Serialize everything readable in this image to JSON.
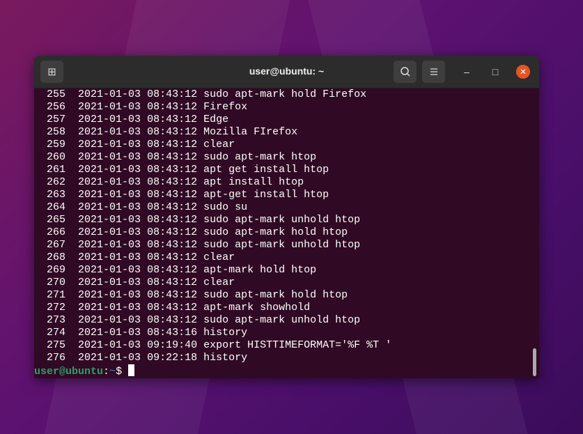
{
  "window": {
    "title": "user@ubuntu: ~"
  },
  "header": {
    "new_tab_icon": "new-tab-icon",
    "search_icon": "search-icon",
    "menu_icon": "hamburger-menu-icon",
    "minimize": "–",
    "maximize": "□",
    "close": "✕"
  },
  "history": [
    {
      "num": "255",
      "date": "2021-01-03",
      "time": "08:43:12",
      "cmd": "sudo apt-mark hold Firefox"
    },
    {
      "num": "256",
      "date": "2021-01-03",
      "time": "08:43:12",
      "cmd": "Firefox"
    },
    {
      "num": "257",
      "date": "2021-01-03",
      "time": "08:43:12",
      "cmd": "Edge"
    },
    {
      "num": "258",
      "date": "2021-01-03",
      "time": "08:43:12",
      "cmd": "Mozilla FIrefox"
    },
    {
      "num": "259",
      "date": "2021-01-03",
      "time": "08:43:12",
      "cmd": "clear"
    },
    {
      "num": "260",
      "date": "2021-01-03",
      "time": "08:43:12",
      "cmd": "sudo apt-mark htop"
    },
    {
      "num": "261",
      "date": "2021-01-03",
      "time": "08:43:12",
      "cmd": "apt get install htop"
    },
    {
      "num": "262",
      "date": "2021-01-03",
      "time": "08:43:12",
      "cmd": "apt install htop"
    },
    {
      "num": "263",
      "date": "2021-01-03",
      "time": "08:43:12",
      "cmd": "apt-get install htop"
    },
    {
      "num": "264",
      "date": "2021-01-03",
      "time": "08:43:12",
      "cmd": "sudo su"
    },
    {
      "num": "265",
      "date": "2021-01-03",
      "time": "08:43:12",
      "cmd": "sudo apt-mark unhold htop"
    },
    {
      "num": "266",
      "date": "2021-01-03",
      "time": "08:43:12",
      "cmd": "sudo apt-mark hold htop"
    },
    {
      "num": "267",
      "date": "2021-01-03",
      "time": "08:43:12",
      "cmd": "sudo apt-mark unhold htop"
    },
    {
      "num": "268",
      "date": "2021-01-03",
      "time": "08:43:12",
      "cmd": "clear"
    },
    {
      "num": "269",
      "date": "2021-01-03",
      "time": "08:43:12",
      "cmd": "apt-mark hold htop"
    },
    {
      "num": "270",
      "date": "2021-01-03",
      "time": "08:43:12",
      "cmd": "clear"
    },
    {
      "num": "271",
      "date": "2021-01-03",
      "time": "08:43:12",
      "cmd": "sudo apt-mark hold htop"
    },
    {
      "num": "272",
      "date": "2021-01-03",
      "time": "08:43:12",
      "cmd": "apt-mark showhold"
    },
    {
      "num": "273",
      "date": "2021-01-03",
      "time": "08:43:12",
      "cmd": "sudo apt-mark unhold htop"
    },
    {
      "num": "274",
      "date": "2021-01-03",
      "time": "08:43:16",
      "cmd": "history"
    },
    {
      "num": "275",
      "date": "2021-01-03",
      "time": "09:19:40",
      "cmd": "export HISTTIMEFORMAT='%F %T '"
    },
    {
      "num": "276",
      "date": "2021-01-03",
      "time": "09:22:18",
      "cmd": "history"
    }
  ],
  "prompt": {
    "user": "user@ubuntu",
    "sep": ":",
    "path": "~",
    "symbol": "$ "
  }
}
